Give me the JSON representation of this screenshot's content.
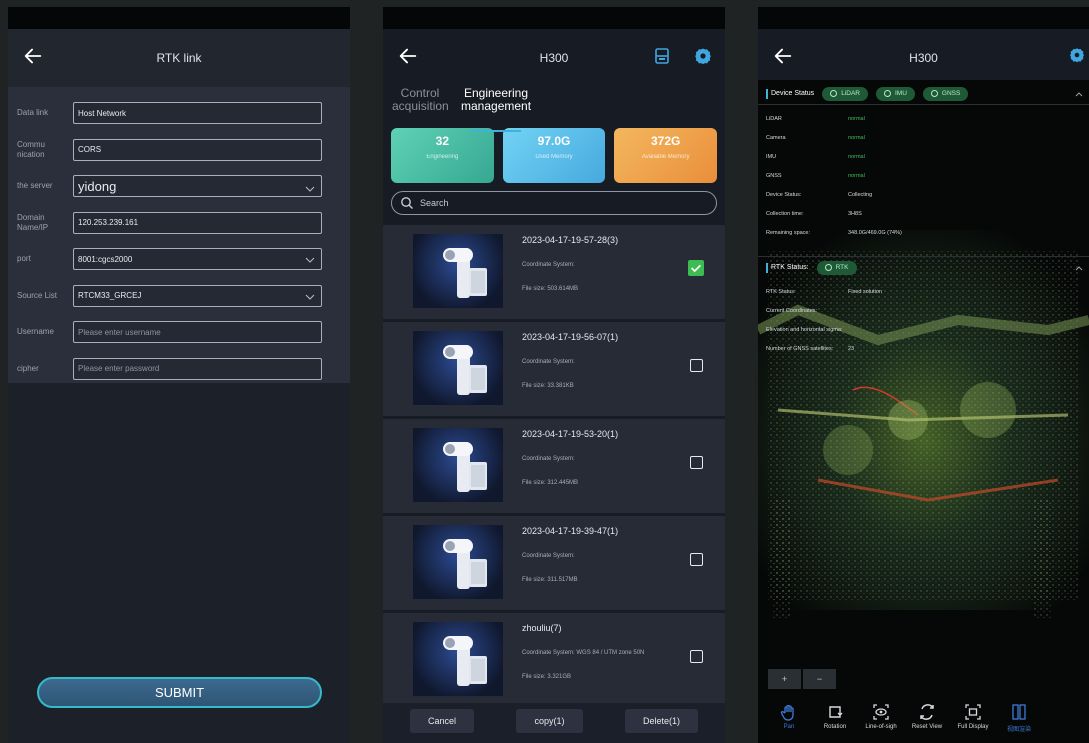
{
  "rtk": {
    "title": "RTK link",
    "fields": [
      {
        "label": "Data link",
        "value": "Host Network",
        "big": false,
        "dropdown": false,
        "placeholder": false
      },
      {
        "label": "Commu nication",
        "value": "CORS",
        "big": false,
        "dropdown": false,
        "placeholder": false
      },
      {
        "label": "the server",
        "value": "yidong",
        "big": true,
        "dropdown": true,
        "placeholder": false
      },
      {
        "label": "Domain Name/IP",
        "value": "120.253.239.161",
        "big": false,
        "dropdown": false,
        "placeholder": false
      },
      {
        "label": "port",
        "value": "8001:cgcs2000",
        "big": false,
        "dropdown": true,
        "placeholder": false
      },
      {
        "label": "Source List",
        "value": "RTCM33_GRCEJ",
        "big": false,
        "dropdown": true,
        "placeholder": false
      },
      {
        "label": "Username",
        "value": "Please enter username",
        "big": false,
        "dropdown": false,
        "placeholder": true
      },
      {
        "label": "cipher",
        "value": "Please enter password",
        "big": false,
        "dropdown": false,
        "placeholder": true
      }
    ],
    "submit_label": "SUBMIT"
  },
  "projects": {
    "title": "H300",
    "tabs": [
      "Control acquisition",
      "Engineering management"
    ],
    "cards": [
      {
        "value": "32",
        "label": "Engineering"
      },
      {
        "value": "97.0G",
        "label": "Used Memory"
      },
      {
        "value": "372G",
        "label": "Available Memory"
      }
    ],
    "search_placeholder": "Search",
    "items": [
      {
        "name": "2023-04-17-19-57-28(3)",
        "coord": "Coordinate System:",
        "size": "File size:  503.614MB",
        "checked": true
      },
      {
        "name": "2023-04-17-19-56-07(1)",
        "coord": "Coordinate System:",
        "size": "File size:  33.381KB",
        "checked": false
      },
      {
        "name": "2023-04-17-19-53-20(1)",
        "coord": "Coordinate System:",
        "size": "File size:  312.445MB",
        "checked": false
      },
      {
        "name": "2023-04-17-19-39-47(1)",
        "coord": "Coordinate System:",
        "size": "File size:  311.517MB",
        "checked": false
      },
      {
        "name": "zhouliu(7)",
        "coord": "Coordinate System:  WGS 84 / UTM zone 50N",
        "size": "File size:  3.321GB",
        "checked": false
      }
    ],
    "buttons": {
      "cancel": "Cancel",
      "copy": "copy(1)",
      "delete": "Delete(1)"
    }
  },
  "viewer": {
    "title": "H300",
    "device_status": {
      "title": "Device Status",
      "pills": [
        "LiDAR",
        "IMU",
        "GNSS"
      ],
      "rows": [
        {
          "k": "LiDAR",
          "v": "normal"
        },
        {
          "k": "Camera",
          "v": "normal"
        },
        {
          "k": "IMU",
          "v": "normal"
        },
        {
          "k": "GNSS",
          "v": "normal"
        },
        {
          "k": "Device Status:",
          "v": "Collecting"
        },
        {
          "k": "Collection time:",
          "v": "3H8S"
        },
        {
          "k": "Remaining space:",
          "v": "348.0G/469.0G (74%)"
        }
      ]
    },
    "rtk_status": {
      "title": "RTK Status:",
      "pill": "RTK",
      "rows": [
        {
          "k": "RTK Status:",
          "v": "Fixed solution"
        },
        {
          "k": "Current Coordinates:",
          "v": ""
        },
        {
          "k": "Elevation and horizontal sigma:",
          "v": ""
        },
        {
          "k": "Number of GNSS satellites:",
          "v": "23"
        }
      ]
    },
    "zoom": [
      "+",
      "−"
    ],
    "tools": [
      "Pan",
      "Rotation",
      "Line-of-sigh",
      "Reset View",
      "Full Display",
      "视图渲染"
    ],
    "colors": {
      "accent": "#3fb2d5",
      "green": "#3fbf5a",
      "selected": "#3d7ad8"
    }
  }
}
